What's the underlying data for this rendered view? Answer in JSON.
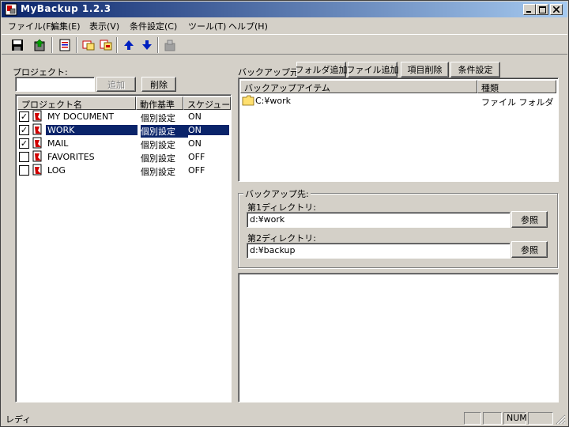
{
  "window": {
    "title": "MyBackup 1.2.3"
  },
  "menu": [
    "ファイル(F)",
    "編集(E)",
    "表示(V)",
    "条件設定(C)",
    "ツール(T)",
    "ヘルプ(H)"
  ],
  "project": {
    "label": "プロジェクト:",
    "input_value": "",
    "add_label": "追加",
    "delete_label": "削除",
    "columns": [
      "プロジェクト名",
      "動作基準",
      "スケジュール"
    ],
    "rows": [
      {
        "name": "MY DOCUMENT",
        "mode": "個別設定",
        "schedule": "ON",
        "checked": true,
        "selected": false
      },
      {
        "name": "WORK",
        "mode": "個別設定",
        "schedule": "ON",
        "checked": true,
        "selected": true
      },
      {
        "name": "MAIL",
        "mode": "個別設定",
        "schedule": "ON",
        "checked": true,
        "selected": false
      },
      {
        "name": "FAVORITES",
        "mode": "個別設定",
        "schedule": "OFF",
        "checked": false,
        "selected": false
      },
      {
        "name": "LOG",
        "mode": "個別設定",
        "schedule": "OFF",
        "checked": false,
        "selected": false
      }
    ]
  },
  "source": {
    "label": "バックアップ元:",
    "add_folder": "フォルダ追加",
    "add_file": "ファイル追加",
    "delete_item": "項目削除",
    "conditions": "条件設定",
    "columns": [
      "バックアップアイテム",
      "種類"
    ],
    "items": [
      {
        "path": "C:¥work",
        "type": "ファイル フォルダ"
      }
    ]
  },
  "dest": {
    "label": "バックアップ先:",
    "dir1_label": "第1ディレクトリ:",
    "dir1_value": "d:¥work",
    "dir2_label": "第2ディレクトリ:",
    "dir2_value": "d:¥backup",
    "browse_label": "参照"
  },
  "status": {
    "text": "レディ",
    "num": "NUM"
  },
  "colors": {
    "selection": "#0a246a",
    "titlebar_start": "#0a246a",
    "titlebar_end": "#a6caf0",
    "face": "#d4d0c8"
  }
}
